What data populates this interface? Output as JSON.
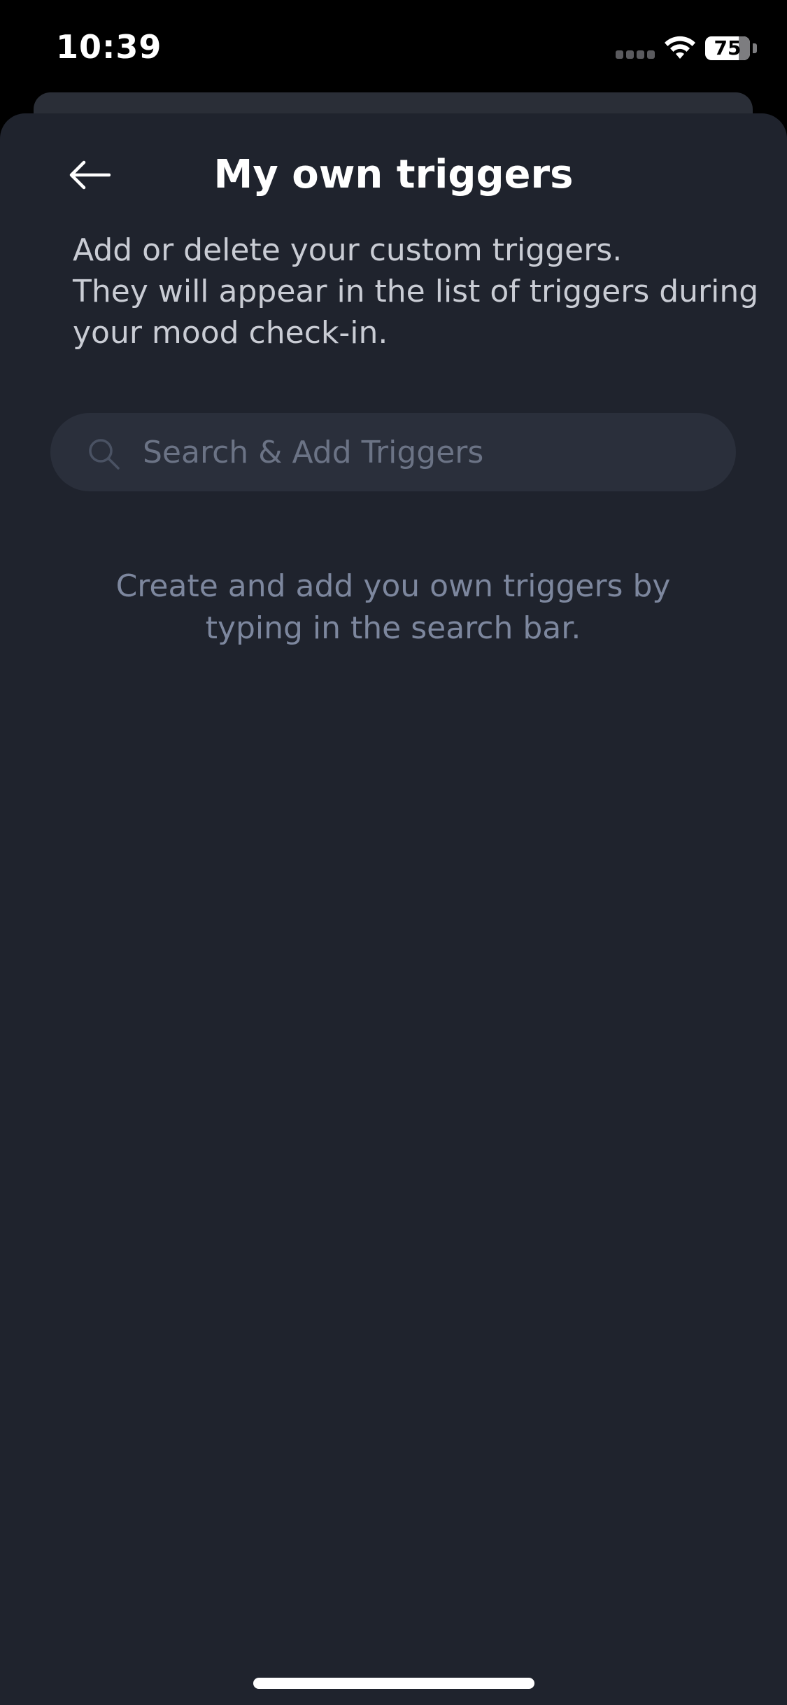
{
  "status_bar": {
    "time": "10:39",
    "battery_level": "75",
    "battery_fraction": 0.75,
    "icons": [
      "signal-dots",
      "wifi-icon",
      "battery-icon"
    ]
  },
  "header": {
    "back_icon": "arrow-left-icon",
    "title": "My own triggers"
  },
  "description": {
    "lines": [
      "Add or delete your custom triggers.",
      "They will appear in the list of triggers during",
      "your mood check-in."
    ]
  },
  "search": {
    "icon": "search-icon",
    "placeholder": "Search & Add Triggers",
    "value": ""
  },
  "empty_state": {
    "lines": [
      "Create and add you own triggers by",
      "typing in the search bar."
    ]
  },
  "colors": {
    "background": "#1f232d",
    "search_bg": "#2a2f3b",
    "title": "#ffffff",
    "description": "#c9ccd4",
    "hint": "#7d879e"
  }
}
